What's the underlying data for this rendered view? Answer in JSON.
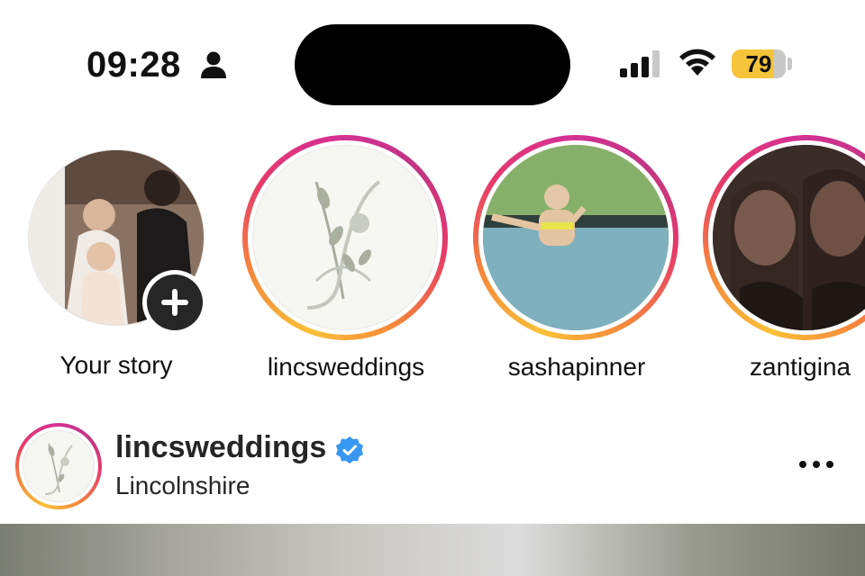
{
  "status_bar": {
    "time": "09:28",
    "battery_percent": "79",
    "battery_level": 0.79,
    "icons": [
      "person-icon",
      "signal-icon",
      "wifi-icon",
      "battery-icon"
    ]
  },
  "stories": [
    {
      "label": "Your story",
      "has_ring": false,
      "add_icon": "plus-icon"
    },
    {
      "label": "lincsweddings",
      "has_ring": true
    },
    {
      "label": "sashapinner",
      "has_ring": true
    },
    {
      "label": "zantigina",
      "has_ring": true
    }
  ],
  "post": {
    "username": "lincsweddings",
    "verified": true,
    "location": "Lincolnshire",
    "menu_icon": "more-horizontal-icon"
  },
  "colors": {
    "battery": "#f5c43a",
    "verified_blue": "#3897f0",
    "story_ring_start": "#f9c138",
    "story_ring_end": "#c13584"
  }
}
